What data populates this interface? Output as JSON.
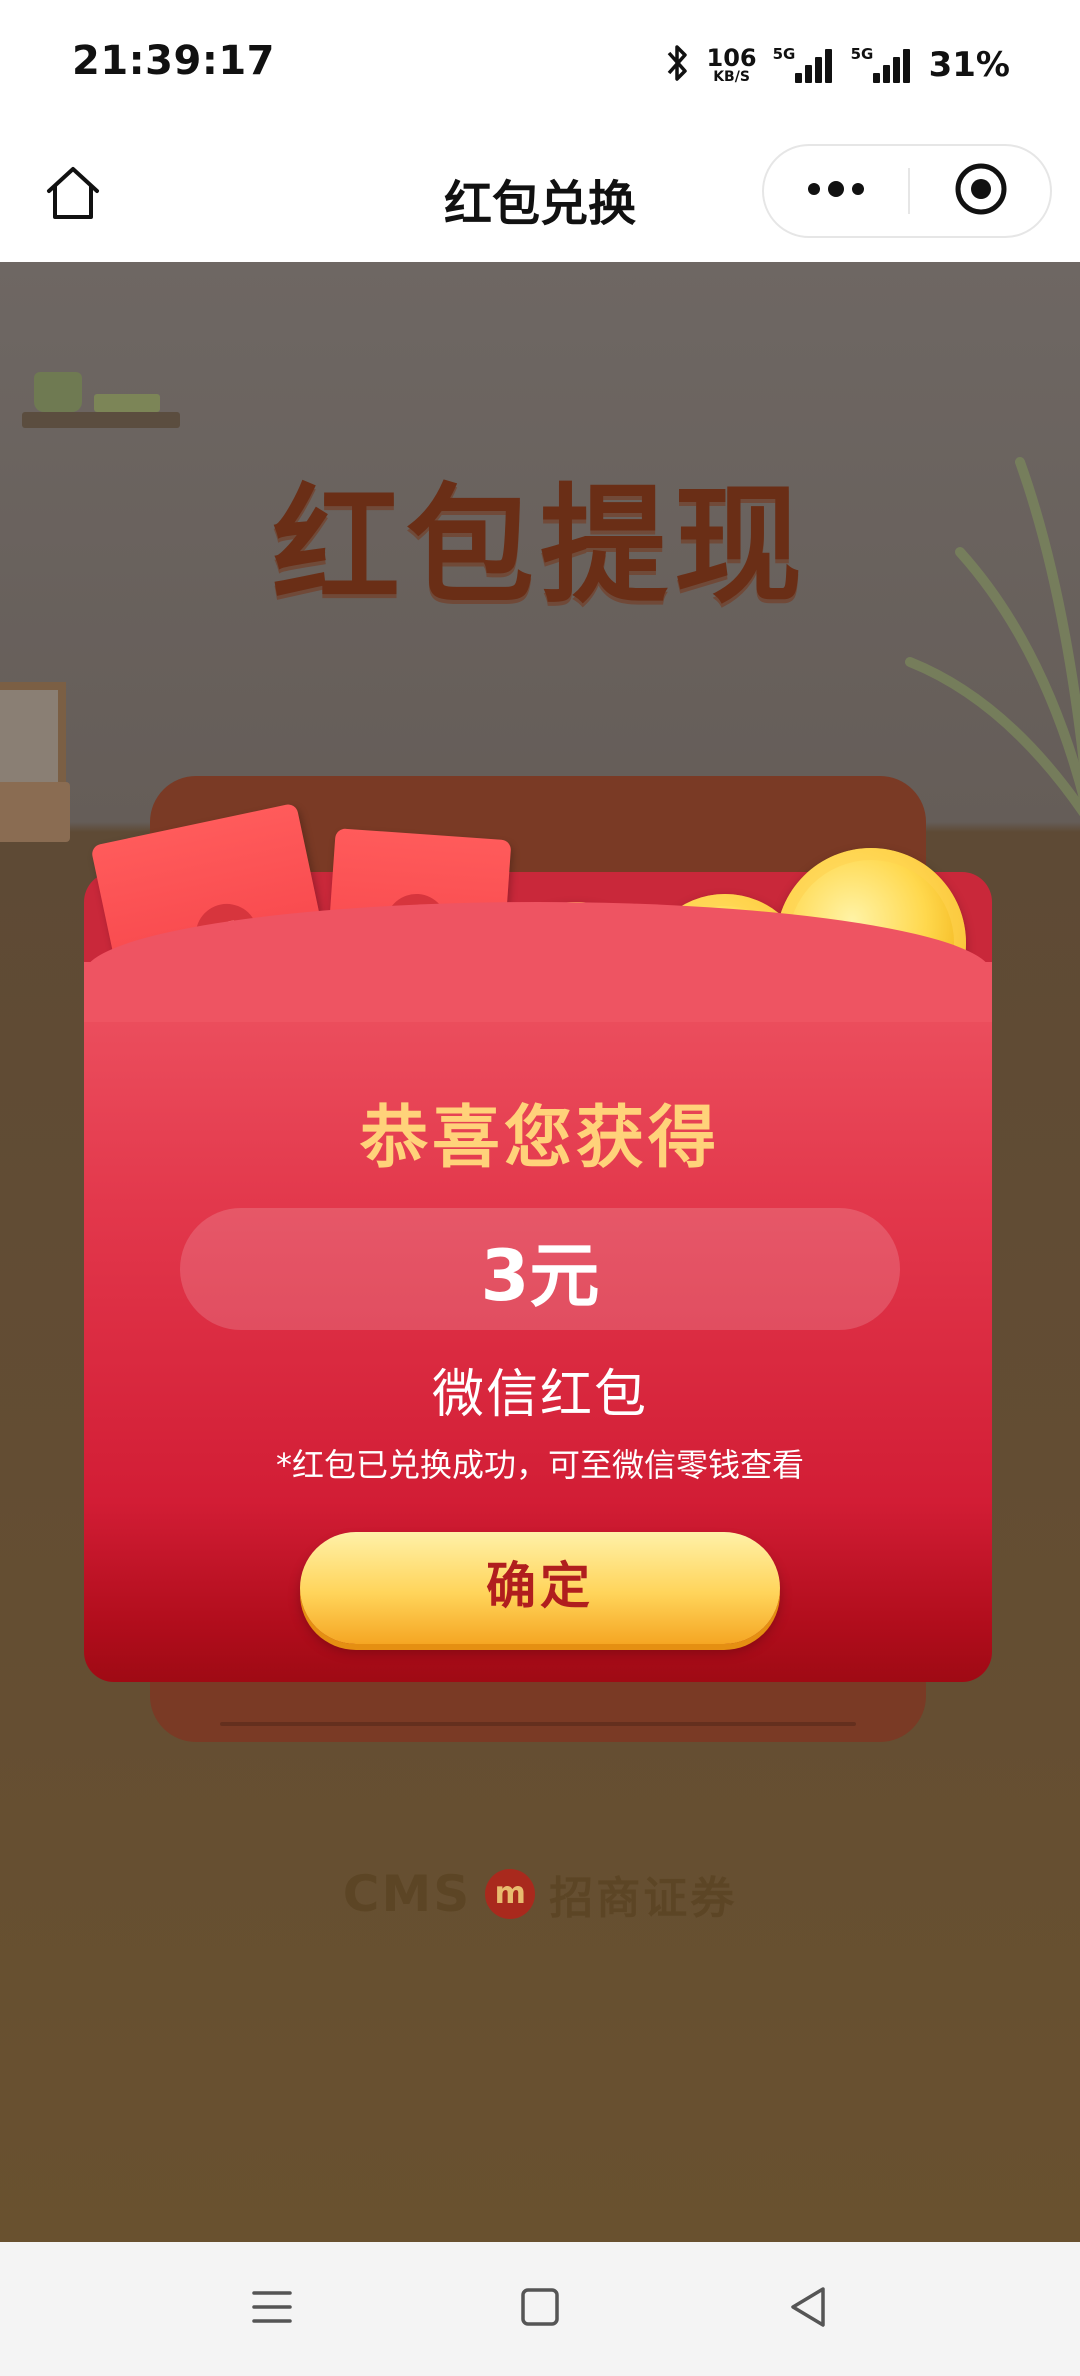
{
  "status_bar": {
    "time": "21:39:17",
    "network_speed_value": "106",
    "network_speed_unit": "KB/S",
    "signal_1_tag": "5G",
    "signal_2_tag": "5G",
    "battery": "31%",
    "icons": [
      "bluetooth-icon",
      "signal-icon",
      "signal-icon"
    ]
  },
  "title_bar": {
    "title": "红包兑换",
    "icons": [
      "home-icon",
      "more-icon",
      "close-target-icon"
    ]
  },
  "scene": {
    "heading": "红包提现",
    "card": {
      "congrats": "恭喜您获得",
      "amount": "3元",
      "type": "微信红包",
      "note": "*红包已兑换成功，可至微信零钱查看",
      "confirm_label": "确定",
      "seal_symbol": "¥"
    },
    "brand": {
      "cms": "CMS",
      "logo_text": "m",
      "name": "招商证券"
    }
  },
  "nav_bar": {
    "icons": [
      "menu-icon",
      "home-square-icon",
      "back-icon"
    ]
  },
  "colors": {
    "card_red": "#d21d35",
    "congrats_gold": "#ffd27a",
    "button_gold": "#ffd45a",
    "button_text": "#b01e1e",
    "heading_brown": "#6a2e16"
  }
}
